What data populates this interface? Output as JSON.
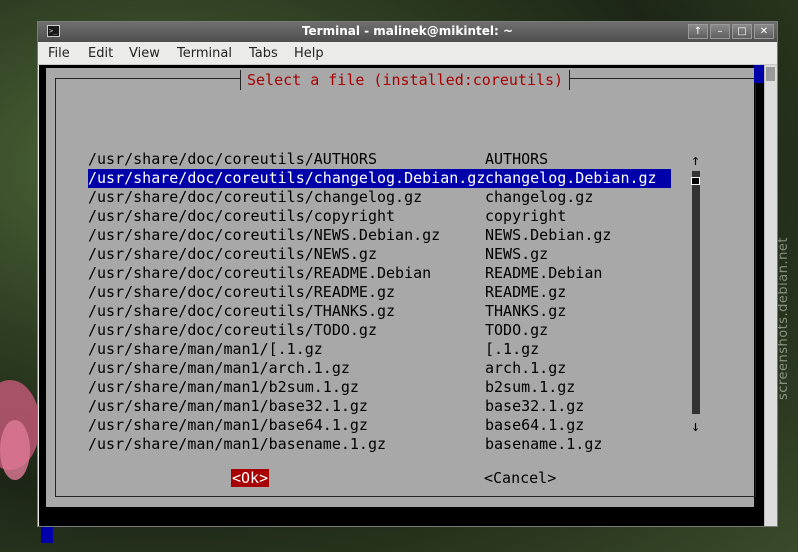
{
  "watermark": "screenshots.debian.net",
  "window": {
    "title": "Terminal - malinek@mikintel: ~",
    "buttons": [
      "↑",
      "–",
      "□",
      "✕"
    ]
  },
  "menu": {
    "file": "File",
    "edit": "Edit",
    "view": "View",
    "terminal": "Terminal",
    "tabs": "Tabs",
    "help": "Help"
  },
  "dialog": {
    "title": "Select a file (installed:coreutils)",
    "ok_label": "<Ok>",
    "cancel_label": "<Cancel>",
    "scroll_up": "↑",
    "scroll_down": "↓",
    "selected_index": 1,
    "rows": [
      {
        "path": "/usr/share/doc/coreutils/AUTHORS",
        "name": "AUTHORS"
      },
      {
        "path": "/usr/share/doc/coreutils/changelog.Debian.gz",
        "name": "changelog.Debian.gz"
      },
      {
        "path": "/usr/share/doc/coreutils/changelog.gz",
        "name": "changelog.gz"
      },
      {
        "path": "/usr/share/doc/coreutils/copyright",
        "name": "copyright"
      },
      {
        "path": "/usr/share/doc/coreutils/NEWS.Debian.gz",
        "name": "NEWS.Debian.gz"
      },
      {
        "path": "/usr/share/doc/coreutils/NEWS.gz",
        "name": "NEWS.gz"
      },
      {
        "path": "/usr/share/doc/coreutils/README.Debian",
        "name": "README.Debian"
      },
      {
        "path": "/usr/share/doc/coreutils/README.gz",
        "name": "README.gz"
      },
      {
        "path": "/usr/share/doc/coreutils/THANKS.gz",
        "name": "THANKS.gz"
      },
      {
        "path": "/usr/share/doc/coreutils/TODO.gz",
        "name": "TODO.gz"
      },
      {
        "path": "/usr/share/man/man1/[.1.gz",
        "name": "[.1.gz"
      },
      {
        "path": "/usr/share/man/man1/arch.1.gz",
        "name": "arch.1.gz"
      },
      {
        "path": "/usr/share/man/man1/b2sum.1.gz",
        "name": "b2sum.1.gz"
      },
      {
        "path": "/usr/share/man/man1/base32.1.gz",
        "name": "base32.1.gz"
      },
      {
        "path": "/usr/share/man/man1/base64.1.gz",
        "name": "base64.1.gz"
      },
      {
        "path": "/usr/share/man/man1/basename.1.gz",
        "name": "basename.1.gz"
      }
    ]
  },
  "colors": {
    "dialog_bg": "#a8a8a8",
    "selection": "#0000aa",
    "title_text": "#a80000",
    "ok_button": "#a80000"
  }
}
